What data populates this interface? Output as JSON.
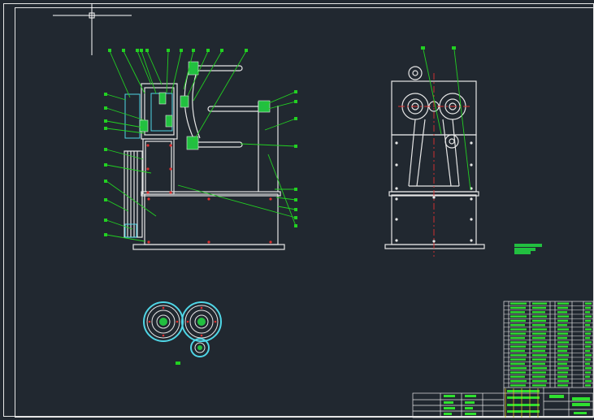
{
  "app": {
    "title": ""
  },
  "colors": {
    "background": "#212830",
    "line": "#e6e6e6",
    "leader": "#22d022",
    "center": "#e03030",
    "cyan": "#4fd6e6",
    "table_text": "#2fe02f"
  },
  "drawing": {
    "front_view": {
      "balloon_count": 22
    },
    "side_view": {
      "balloon_count": 2
    },
    "gear_detail": {
      "gear_count": 3
    },
    "parts_list": {
      "row_count": 20
    },
    "title_block": {
      "present": true
    }
  }
}
